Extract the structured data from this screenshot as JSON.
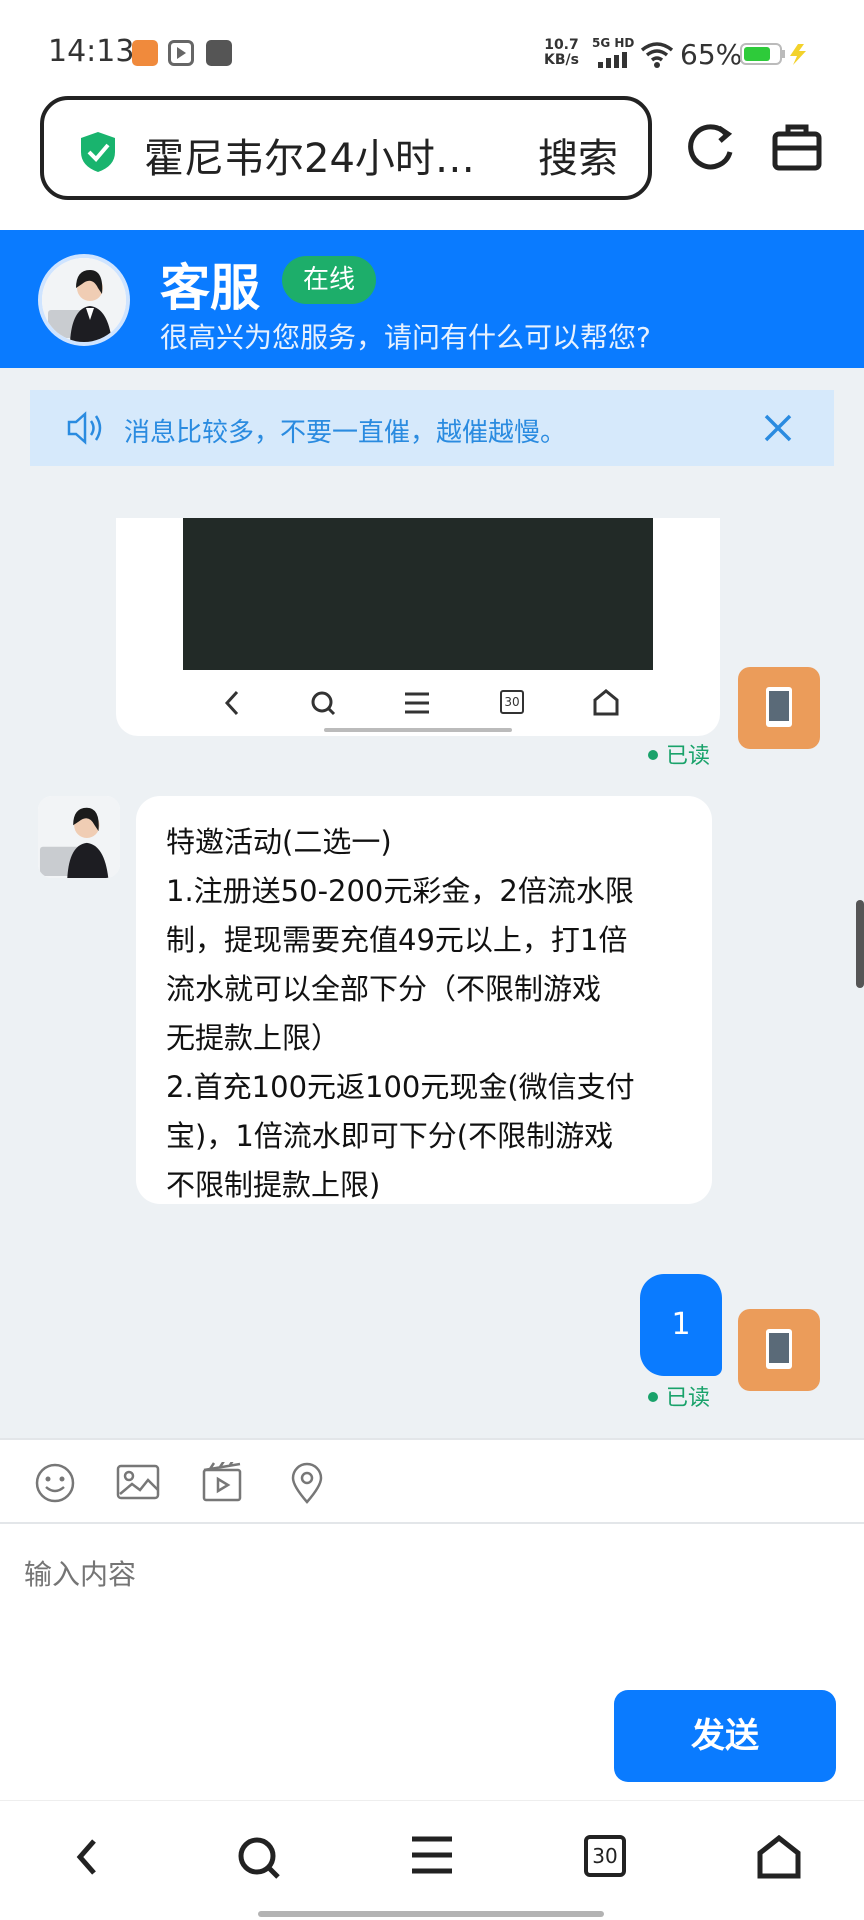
{
  "status_bar": {
    "time": "14:13",
    "net_speed_value": "10.7",
    "net_speed_unit": "KB/s",
    "network_label": "5G HD",
    "battery": "65%"
  },
  "browser": {
    "url_title": "霍尼韦尔24小时…",
    "search_label": "搜索",
    "refresh_icon": "refresh-icon",
    "toolbox_icon": "toolbox-icon"
  },
  "chat_header": {
    "name": "客服",
    "status": "在线",
    "greeting": "很高兴为您服务，请问有什么可以帮您?"
  },
  "notice": {
    "text": "消息比较多，不要一直催，越催越慢。"
  },
  "messages": {
    "image_nav_badge": "30",
    "read_label_1": "已读",
    "agent_lines": [
      "特邀活动(二选一)",
      "1.注册送50-200元彩金，2倍流水限",
      "制，提现需要充值49元以上，打1倍",
      "流水就可以全部下分（不限制游戏",
      "无提款上限）",
      "2.首充100元返100元现金(微信支付",
      "宝)，1倍流水即可下分(不限制游戏",
      "不限制提款上限)"
    ],
    "user_text": "1",
    "read_label_2": "已读"
  },
  "input": {
    "placeholder": "输入内容",
    "send_label": "发送"
  },
  "bottom_nav": {
    "tabs_count": "30"
  },
  "colors": {
    "brand_blue": "#0a7bff",
    "online_green": "#1dae6a",
    "notice_bg": "#d6e9fb",
    "chat_bg": "#edf1f4",
    "user_avatar": "#eb9c5a"
  }
}
